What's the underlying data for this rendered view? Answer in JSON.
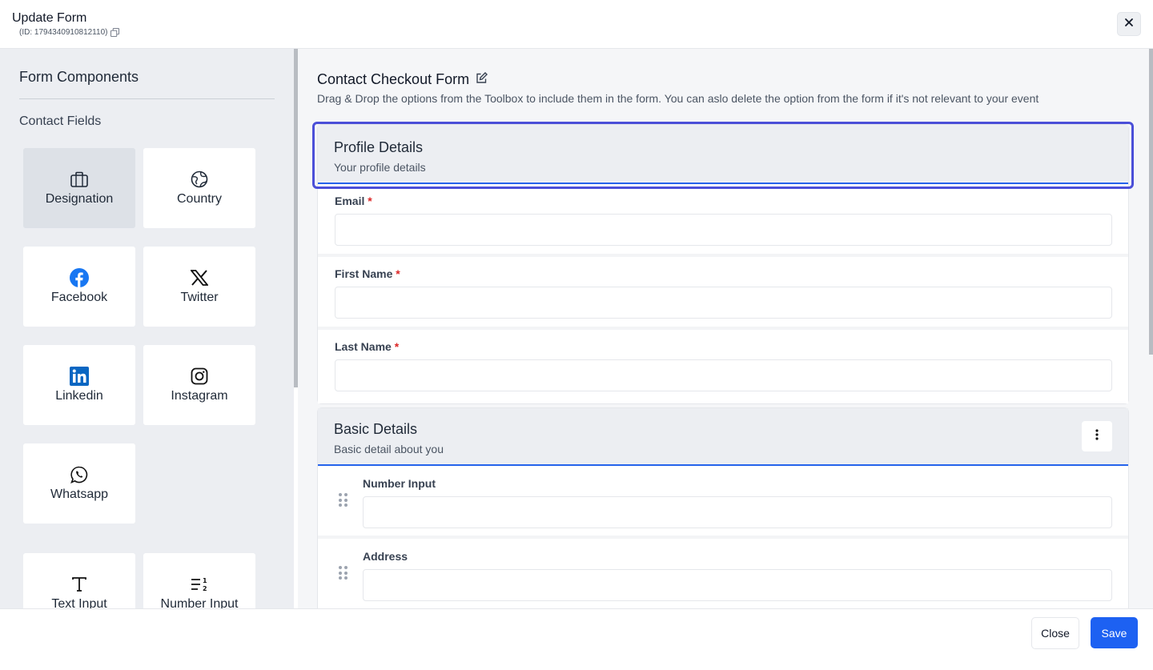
{
  "header": {
    "title": "Update Form",
    "id_text": "(ID: 1794340910812110)"
  },
  "sidebar": {
    "title": "Form Components",
    "section": "Contact Fields",
    "tiles": [
      {
        "label": "Designation",
        "icon": "briefcase-icon"
      },
      {
        "label": "Country",
        "icon": "globe-icon"
      },
      {
        "label": "Facebook",
        "icon": "facebook-icon"
      },
      {
        "label": "Twitter",
        "icon": "x-twitter-icon"
      },
      {
        "label": "Linkedin",
        "icon": "linkedin-icon"
      },
      {
        "label": "Instagram",
        "icon": "instagram-icon"
      },
      {
        "label": "Whatsapp",
        "icon": "whatsapp-icon"
      },
      {
        "label": "Text Input",
        "icon": "text-icon"
      },
      {
        "label": "Number Input",
        "icon": "number-list-icon"
      }
    ]
  },
  "form": {
    "title": "Contact Checkout Form",
    "subtitle": "Drag & Drop the options from the Toolbox to include them in the form. You can aslo delete the option from the form if it's not relevant to your event",
    "sections": [
      {
        "title": "Profile Details",
        "description": "Your profile details",
        "fields": [
          {
            "label": "Email",
            "required": "*",
            "value": ""
          },
          {
            "label": "First Name",
            "required": "*",
            "value": ""
          },
          {
            "label": "Last Name",
            "required": "*",
            "value": ""
          }
        ]
      },
      {
        "title": "Basic Details",
        "description": "Basic detail about you",
        "fields": [
          {
            "label": "Number Input",
            "value": ""
          },
          {
            "label": "Address",
            "value": ""
          }
        ]
      }
    ]
  },
  "footer": {
    "close_label": "Close",
    "save_label": "Save"
  },
  "colors": {
    "accent": "#1d61f2",
    "selection": "#4b4fd8",
    "required": "#dc2626"
  }
}
